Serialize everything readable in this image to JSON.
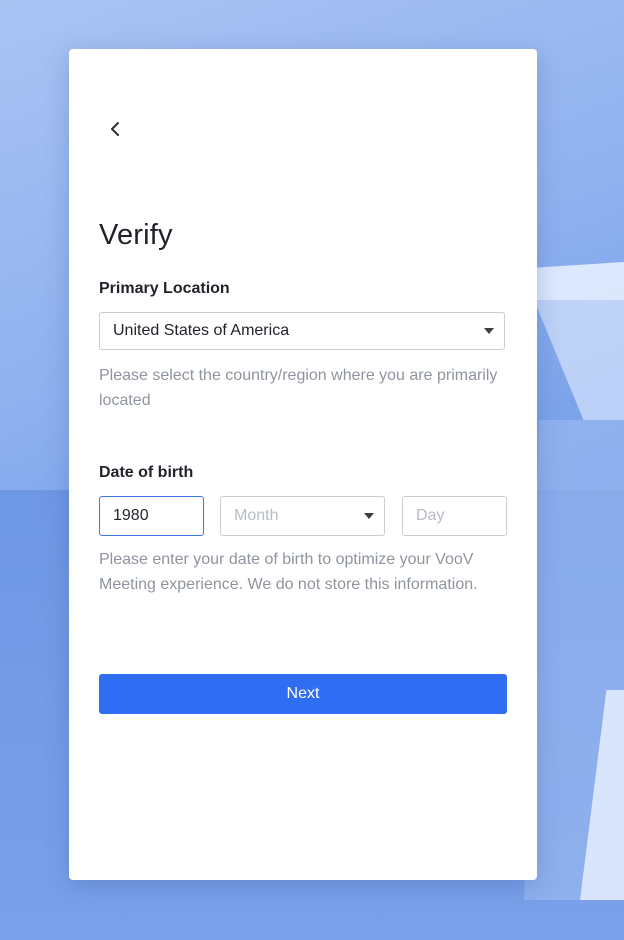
{
  "page": {
    "title": "Verify",
    "back_icon": "chevron-left-icon"
  },
  "location": {
    "label": "Primary Location",
    "selected": "United States of America",
    "hint": "Please select the country/region where you are primarily located"
  },
  "dob": {
    "label": "Date of birth",
    "year_value": "1980",
    "month_placeholder": "Month",
    "day_placeholder": "Day",
    "hint": "Please enter your date of birth to optimize your VooV Meeting experience. We do not store this information."
  },
  "actions": {
    "next_label": "Next"
  },
  "colors": {
    "primary": "#2f6ef2",
    "focus_border": "#3d74e8",
    "hint_text": "#8f959e"
  }
}
